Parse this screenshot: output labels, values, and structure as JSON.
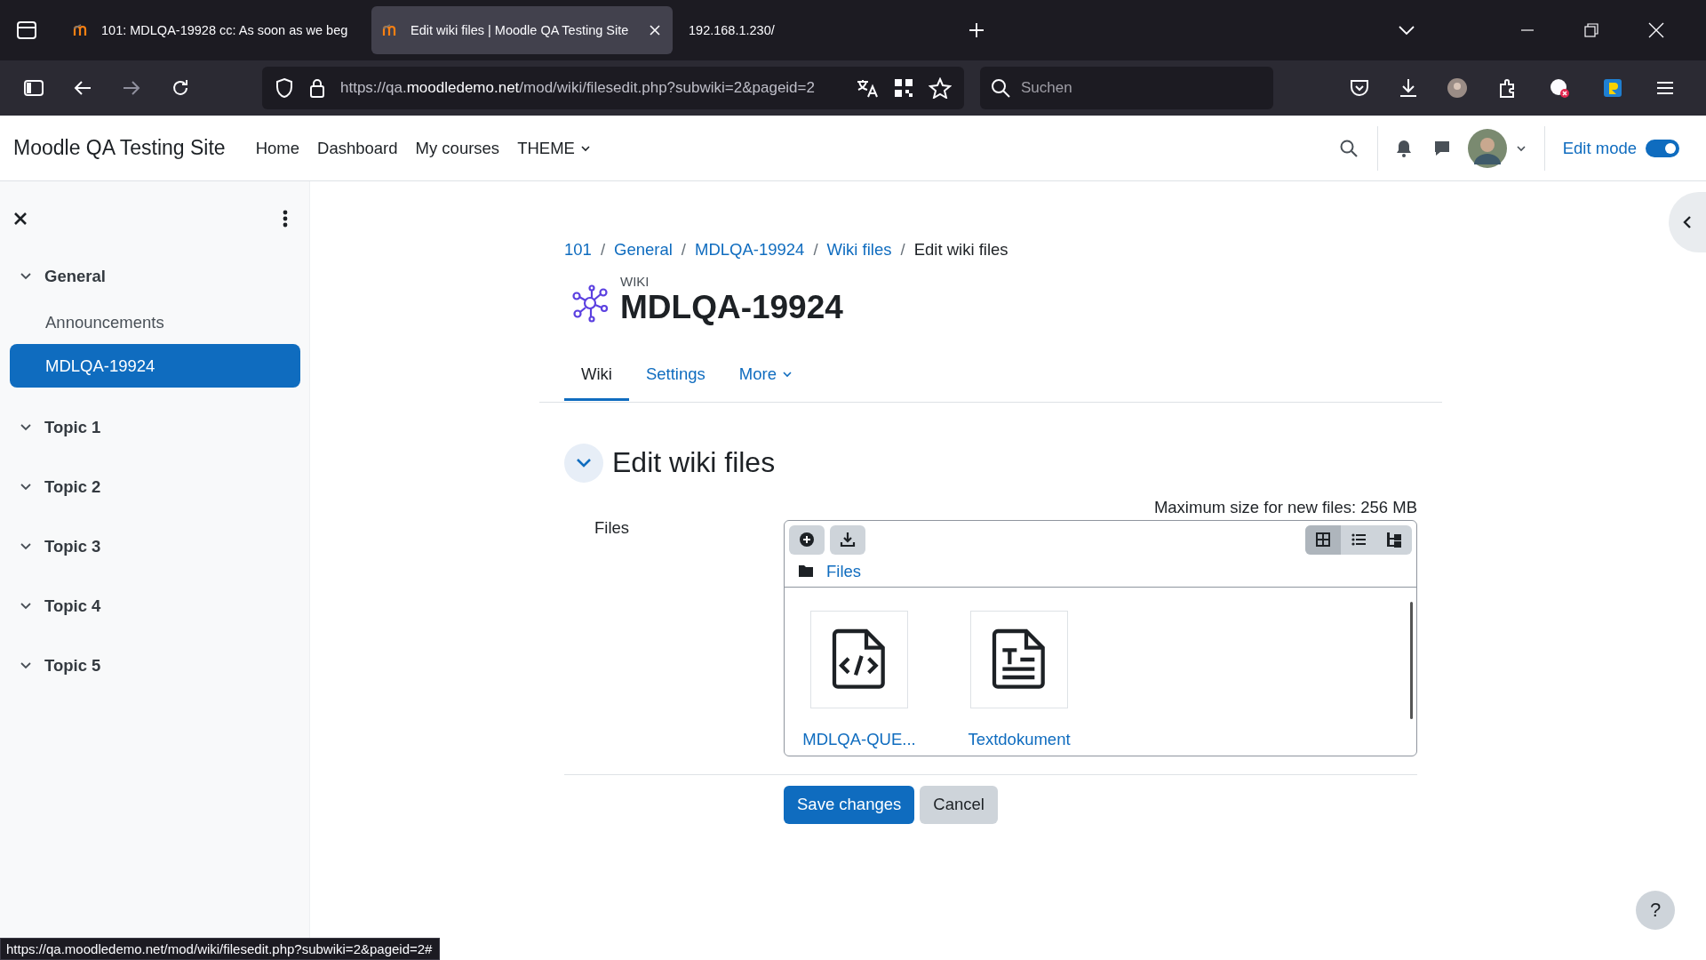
{
  "browser": {
    "tabs": [
      {
        "title": "101: MDLQA-19928 cc: As soon as we beg",
        "selected": false
      },
      {
        "title": "Edit wiki files | Moodle QA Testing Site",
        "selected": true
      },
      {
        "title": "192.168.1.230/",
        "selected": false
      }
    ],
    "url": "https://qa.**moodledemo.net**/mod/wiki/filesedit.php?subwiki=2&pageid=2",
    "search": {
      "placeholder": "Suchen"
    }
  },
  "site": {
    "name": "Moodle QA Testing Site",
    "nav": [
      {
        "label": "Home",
        "dropdown": false
      },
      {
        "label": "Dashboard",
        "dropdown": false
      },
      {
        "label": "My courses",
        "dropdown": false
      },
      {
        "label": "THEME",
        "dropdown": true
      }
    ],
    "edit_mode": {
      "label": "Edit mode",
      "on": true
    }
  },
  "course_index": {
    "sections": [
      {
        "title": "General",
        "expanded": true,
        "items": [
          {
            "label": "Announcements",
            "selected": false
          },
          {
            "label": "MDLQA-19924",
            "selected": true
          }
        ]
      },
      {
        "title": "Topic 1",
        "expanded": true
      },
      {
        "title": "Topic 2",
        "expanded": true
      },
      {
        "title": "Topic 3",
        "expanded": true
      },
      {
        "title": "Topic 4",
        "expanded": true
      },
      {
        "title": "Topic 5",
        "expanded": true
      }
    ]
  },
  "breadcrumb": [
    {
      "kind": "link",
      "text": "101"
    },
    {
      "kind": "separator",
      "text": "/"
    },
    {
      "kind": "link",
      "text": "General"
    },
    {
      "kind": "separator",
      "text": "/"
    },
    {
      "kind": "link",
      "text": "MDLQA-19924"
    },
    {
      "kind": "separator",
      "text": "/"
    },
    {
      "kind": "link",
      "text": "Wiki files"
    },
    {
      "kind": "separator",
      "text": "/"
    },
    {
      "kind": "current",
      "text": "Edit wiki files"
    }
  ],
  "activity": {
    "type_label": "WIKI",
    "title": "MDLQA-19924"
  },
  "tabs": [
    {
      "label": "Wiki",
      "selected": true,
      "dropdown": false
    },
    {
      "label": "Settings",
      "selected": false,
      "dropdown": false
    },
    {
      "label": "More",
      "selected": false,
      "dropdown": true
    }
  ],
  "section": {
    "title": "Edit wiki files",
    "expanded": true
  },
  "files_field": {
    "label": "Files",
    "max_size": "Maximum size for new files: 256 MB",
    "path": "Files",
    "views": [
      {
        "kind": "icons",
        "selected": true
      },
      {
        "kind": "list",
        "selected": false
      },
      {
        "kind": "tree",
        "selected": false
      }
    ],
    "files": [
      {
        "name": "MDLQA-QUE...",
        "kind": "code"
      },
      {
        "name": "Textdokument",
        "kind": "text"
      }
    ]
  },
  "buttons": [
    {
      "label": "Save changes",
      "kind": "primary"
    },
    {
      "label": "Cancel",
      "kind": "secondary"
    }
  ],
  "help": {
    "label": "?"
  },
  "status_url": "https://qa.moodledemo.net/mod/wiki/filesedit.php?subwiki=2&pageid=2#"
}
